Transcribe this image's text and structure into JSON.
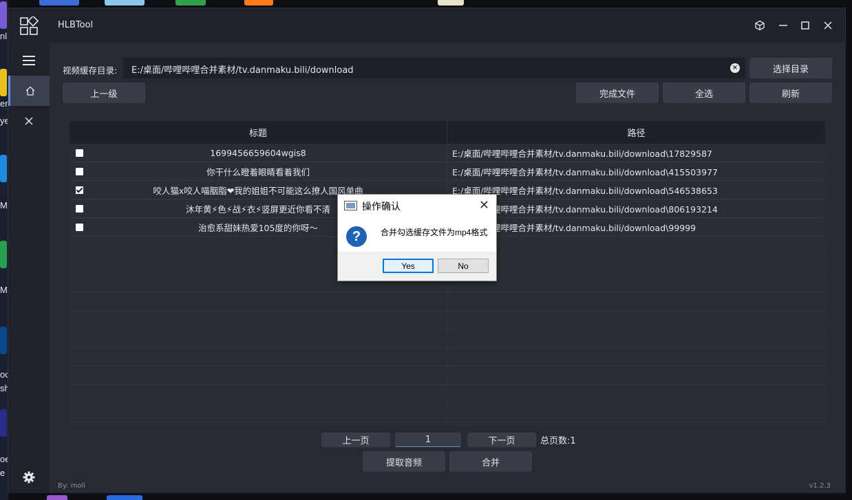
{
  "window": {
    "title": "HLBTool",
    "version": "v1.2.3",
    "author": "By: moli"
  },
  "toolbar": {
    "dir_label": "视频缓存目录:",
    "dir_value": "E:/桌面/哔哩哔哩合并素材/tv.danmaku.bili/download",
    "select_dir_label": "选择目录",
    "up_label": "上一级",
    "done_files_label": "完成文件",
    "select_all_label": "全选",
    "refresh_label": "刷新"
  },
  "table": {
    "columns": [
      "标题",
      "路径"
    ],
    "rows": [
      {
        "title": "1699456659604wgis8",
        "path": "E:/桌面/哔哩哔哩合并素材/tv.danmaku.bili/download\\17829587",
        "checked": false
      },
      {
        "title": "你干什么瞪着眼睛看着我们",
        "path": "E:/桌面/哔哩哔哩合并素材/tv.danmaku.bili/download\\415503977",
        "checked": false
      },
      {
        "title": "咬人猫x咬人喵胭脂❤我的姐姐不可能这么撩人国风单曲",
        "path": "E:/桌面/哔哩哔哩合并素材/tv.danmaku.bili/download\\546538653",
        "checked": true
      },
      {
        "title": "沐年黄⚡色⚡战⚡衣⚡竖屏更近你看不清",
        "path": "E:/桌面/哔哩哔哩合并素材/tv.danmaku.bili/download\\806193214",
        "checked": false
      },
      {
        "title": "治愈系甜妹热爱105度的你呀～",
        "path": "E:/桌面/哔哩哔哩合并素材/tv.danmaku.bili/download\\99999",
        "checked": false
      }
    ]
  },
  "pagination": {
    "prev_label": "上一页",
    "page": "1",
    "next_label": "下一页",
    "total_label": "总页数:1"
  },
  "actions": {
    "extract_audio_label": "提取音频",
    "merge_label": "合并"
  },
  "dialog": {
    "title": "操作确认",
    "message": "合并勾选缓存文件为mp4格式",
    "yes_label": "Yes",
    "no_label": "No"
  },
  "desktop": {
    "side_texts": [
      "nl",
      "er",
      "ye",
      "M",
      "M",
      "oc",
      "sh",
      "oe",
      "e"
    ]
  },
  "colors": {
    "accent": "#6b8dd6",
    "window_bg": "#1f2229",
    "content_bg": "#272a33",
    "button_bg": "#393d48",
    "dialog_question": "#1f63b4"
  }
}
